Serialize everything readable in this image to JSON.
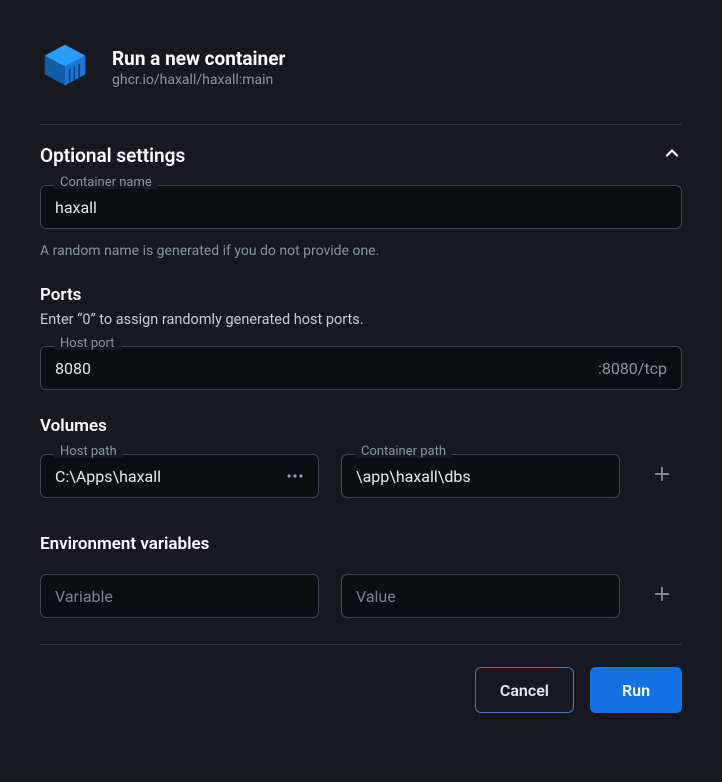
{
  "header": {
    "title": "Run a new container",
    "image_ref": "ghcr.io/haxall/haxall:main"
  },
  "optional": {
    "section_title": "Optional settings",
    "container_name_label": "Container name",
    "container_name_value": "haxall",
    "container_name_helper": "A random name is generated if you do not provide one."
  },
  "ports": {
    "title": "Ports",
    "helper": "Enter “0” to assign randomly generated host ports.",
    "host_port_label": "Host port",
    "host_port_value": "8080",
    "mapping_suffix": ":8080/tcp"
  },
  "volumes": {
    "title": "Volumes",
    "host_path_label": "Host path",
    "host_path_value": "C:\\Apps\\haxall",
    "container_path_label": "Container path",
    "container_path_value": "\\app\\haxall\\dbs"
  },
  "env": {
    "title": "Environment variables",
    "var_placeholder": "Variable",
    "val_placeholder": "Value"
  },
  "footer": {
    "cancel": "Cancel",
    "run": "Run"
  },
  "icons": {
    "container": "container-cube-icon",
    "chevron_up": "chevron-up-icon",
    "ellipsis": "ellipsis-icon",
    "plus": "plus-icon"
  },
  "colors": {
    "accent": "#1373e6",
    "cube": "#1e90ff",
    "border": "#3d4652",
    "bg": "#17191e",
    "input_bg": "#0c0e12"
  }
}
